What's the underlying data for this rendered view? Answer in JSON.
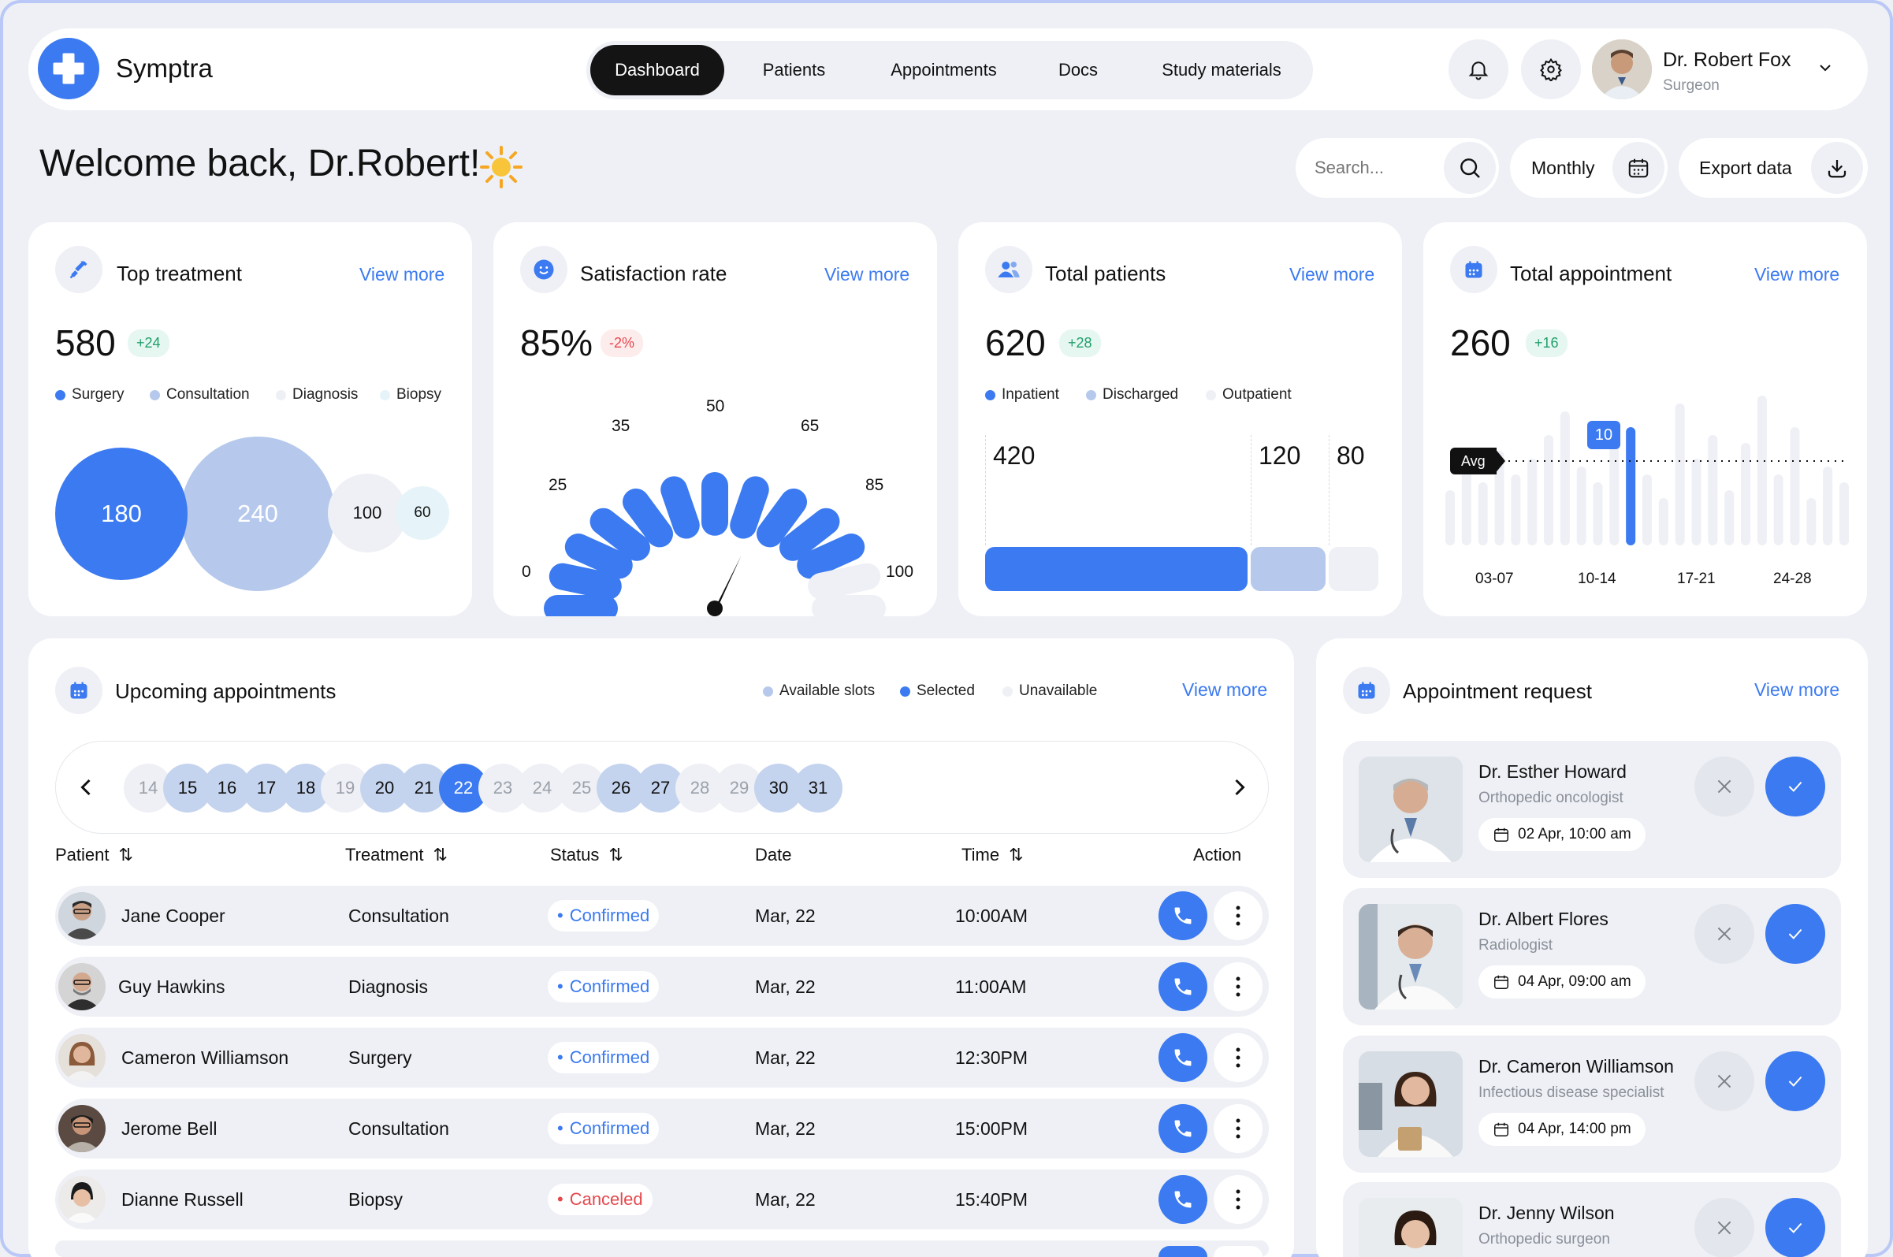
{
  "app": {
    "name": "Symptra",
    "accent": "#3b7af0"
  },
  "nav": {
    "items": [
      "Dashboard",
      "Patients",
      "Appointments",
      "Docs",
      "Study materials"
    ],
    "active": "Dashboard"
  },
  "user": {
    "name": "Dr. Robert Fox",
    "role": "Surgeon"
  },
  "welcome": {
    "text": "Welcome back, Dr.Robert!"
  },
  "toolbar": {
    "search_placeholder": "Search...",
    "period": "Monthly",
    "export": "Export data"
  },
  "top_treatment": {
    "title": "Top treatment",
    "link": "View more",
    "value": "580",
    "delta": "+24",
    "legend": [
      "Surgery",
      "Consultation",
      "Diagnosis",
      "Biopsy"
    ],
    "bubbles": [
      "180",
      "240",
      "100",
      "60"
    ]
  },
  "satisfaction": {
    "title": "Satisfaction rate",
    "link": "View more",
    "value": "85%",
    "delta": "-2%",
    "ticks": [
      "0",
      "25",
      "35",
      "50",
      "65",
      "85",
      "100"
    ],
    "gauge_value": 85
  },
  "total_patients": {
    "title": "Total patients",
    "link": "View more",
    "value": "620",
    "delta": "+28",
    "legend": [
      "Inpatient",
      "Discharged",
      "Outpatient"
    ],
    "segments": [
      {
        "label": "420",
        "value": 420
      },
      {
        "label": "120",
        "value": 120
      },
      {
        "label": "80",
        "value": 80
      }
    ]
  },
  "total_appointment": {
    "title": "Total appointment",
    "link": "View more",
    "value": "260",
    "delta": "+16",
    "avg_label": "Avg",
    "highlight_label": "10",
    "xticks": [
      "03-07",
      "10-14",
      "17-21",
      "24-28"
    ]
  },
  "upcoming": {
    "title": "Upcoming appointments",
    "link": "View more",
    "legend": [
      "Available slots",
      "Selected",
      "Unavailable"
    ],
    "days": [
      "14",
      "15",
      "16",
      "17",
      "18",
      "19",
      "20",
      "21",
      "22",
      "23",
      "24",
      "25",
      "26",
      "27",
      "28",
      "29",
      "30",
      "31"
    ],
    "columns": [
      "Patient",
      "Treatment",
      "Status",
      "Date",
      "Time",
      "Action"
    ],
    "rows": [
      {
        "patient": "Jane Cooper",
        "treatment": "Consultation",
        "status": "Confirmed",
        "date": "Mar, 22",
        "time": "10:00AM"
      },
      {
        "patient": "Guy Hawkins",
        "treatment": "Diagnosis",
        "status": "Confirmed",
        "date": "Mar, 22",
        "time": "11:00AM"
      },
      {
        "patient": "Cameron Williamson",
        "treatment": "Surgery",
        "status": "Confirmed",
        "date": "Mar, 22",
        "time": "12:30PM"
      },
      {
        "patient": "Jerome Bell",
        "treatment": "Consultation",
        "status": "Confirmed",
        "date": "Mar, 22",
        "time": "15:00PM"
      },
      {
        "patient": "Dianne Russell",
        "treatment": "Biopsy",
        "status": "Canceled",
        "date": "Mar, 22",
        "time": "15:40PM"
      }
    ]
  },
  "requests": {
    "title": "Appointment request",
    "link": "View more",
    "items": [
      {
        "name": "Dr. Esther Howard",
        "spec": "Orthopedic oncologist",
        "date": "02 Apr, 10:00 am"
      },
      {
        "name": "Dr. Albert Flores",
        "spec": "Radiologist",
        "date": "04 Apr, 09:00 am"
      },
      {
        "name": "Dr. Cameron Williamson",
        "spec": "Infectious disease specialist",
        "date": "04 Apr, 14:00 pm"
      },
      {
        "name": "Dr. Jenny Wilson",
        "spec": "Orthopedic surgeon",
        "date": ""
      }
    ]
  }
}
